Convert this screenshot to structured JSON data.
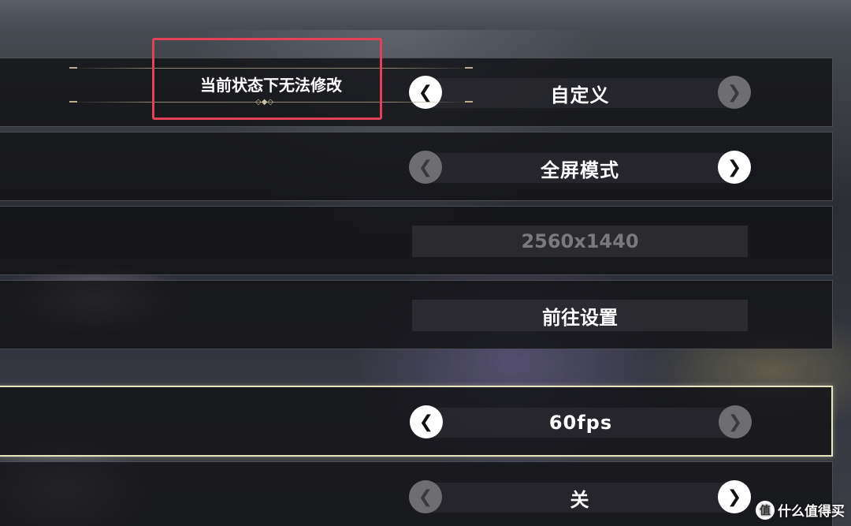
{
  "tooltip": {
    "text": "当前状态下无法修改"
  },
  "rows": [
    {
      "value": "自定义",
      "left_arrow": "chevron-left-icon",
      "right_arrow": "chevron-right-icon",
      "left_enabled": true,
      "right_enabled": false
    },
    {
      "value": "全屏模式",
      "left_arrow": "chevron-left-icon",
      "right_arrow": "chevron-right-icon",
      "left_enabled": false,
      "right_enabled": true
    },
    {
      "value": "2560x1440",
      "disabled": true
    },
    {
      "value": "前往设置"
    },
    {
      "value": "60fps",
      "selected": true,
      "left_enabled": true,
      "right_enabled": false
    },
    {
      "value": "关",
      "left_enabled": false,
      "right_enabled": true
    }
  ],
  "colors": {
    "highlight_box": "#e3415a",
    "selected_border": "#e9e4c2",
    "disabled_text": "#7a7a7e"
  },
  "watermark": {
    "logo": "值",
    "text": "什么值得买"
  }
}
